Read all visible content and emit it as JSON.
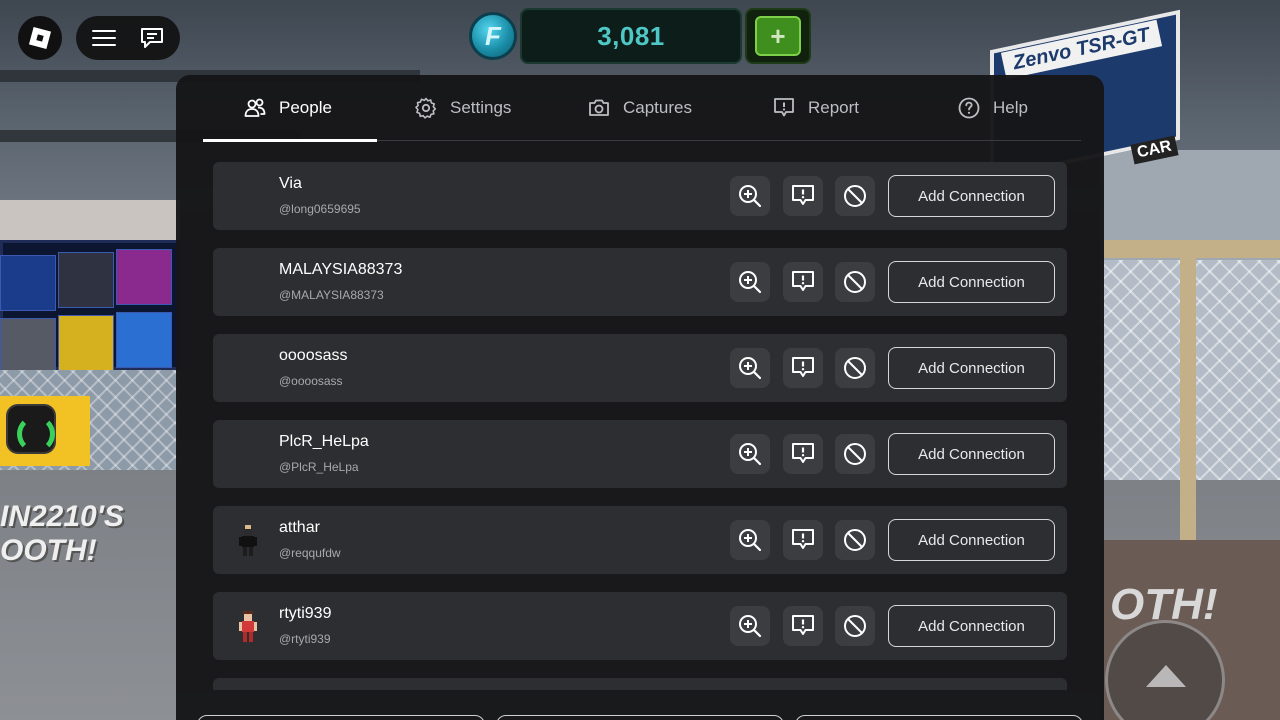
{
  "currency": {
    "icon_letter": "F",
    "value": "3,081",
    "add_label": "+"
  },
  "tabs": [
    {
      "label": "People",
      "icon": "people-icon",
      "active": true
    },
    {
      "label": "Settings",
      "icon": "gear-icon",
      "active": false
    },
    {
      "label": "Captures",
      "icon": "camera-icon",
      "active": false
    },
    {
      "label": "Report",
      "icon": "report-icon",
      "active": false
    },
    {
      "label": "Help",
      "icon": "help-icon",
      "active": false
    }
  ],
  "players": [
    {
      "name": "Via",
      "handle": "@long0659695",
      "action": "Add Connection",
      "has_avatar": false
    },
    {
      "name": "MALAYSIA88373",
      "handle": "@MALAYSIA88373",
      "action": "Add Connection",
      "has_avatar": false
    },
    {
      "name": "oooosass",
      "handle": "@oooosass",
      "action": "Add Connection",
      "has_avatar": false
    },
    {
      "name": "PlcR_HeLpa",
      "handle": "@PlcR_HeLpa",
      "action": "Add Connection",
      "has_avatar": false
    },
    {
      "name": "atthar",
      "handle": "@reqqufdw",
      "action": "Add Connection",
      "has_avatar": true
    },
    {
      "name": "rtyti939",
      "handle": "@rtyti939",
      "action": "Add Connection",
      "has_avatar": true
    }
  ],
  "scene": {
    "banner_title": "Zenvo TSR-GT",
    "banner_tag": "CAR",
    "booth_text": "IN2210'S\nOOTH!",
    "booth_text_right": "OTH!"
  },
  "colors": {
    "panel_bg": "#161618",
    "row_bg": "#2d2e31",
    "icon_btn_bg": "#3c3d41",
    "currency_text": "#4fc7c5",
    "add_currency_green": "#3f8f1f"
  }
}
